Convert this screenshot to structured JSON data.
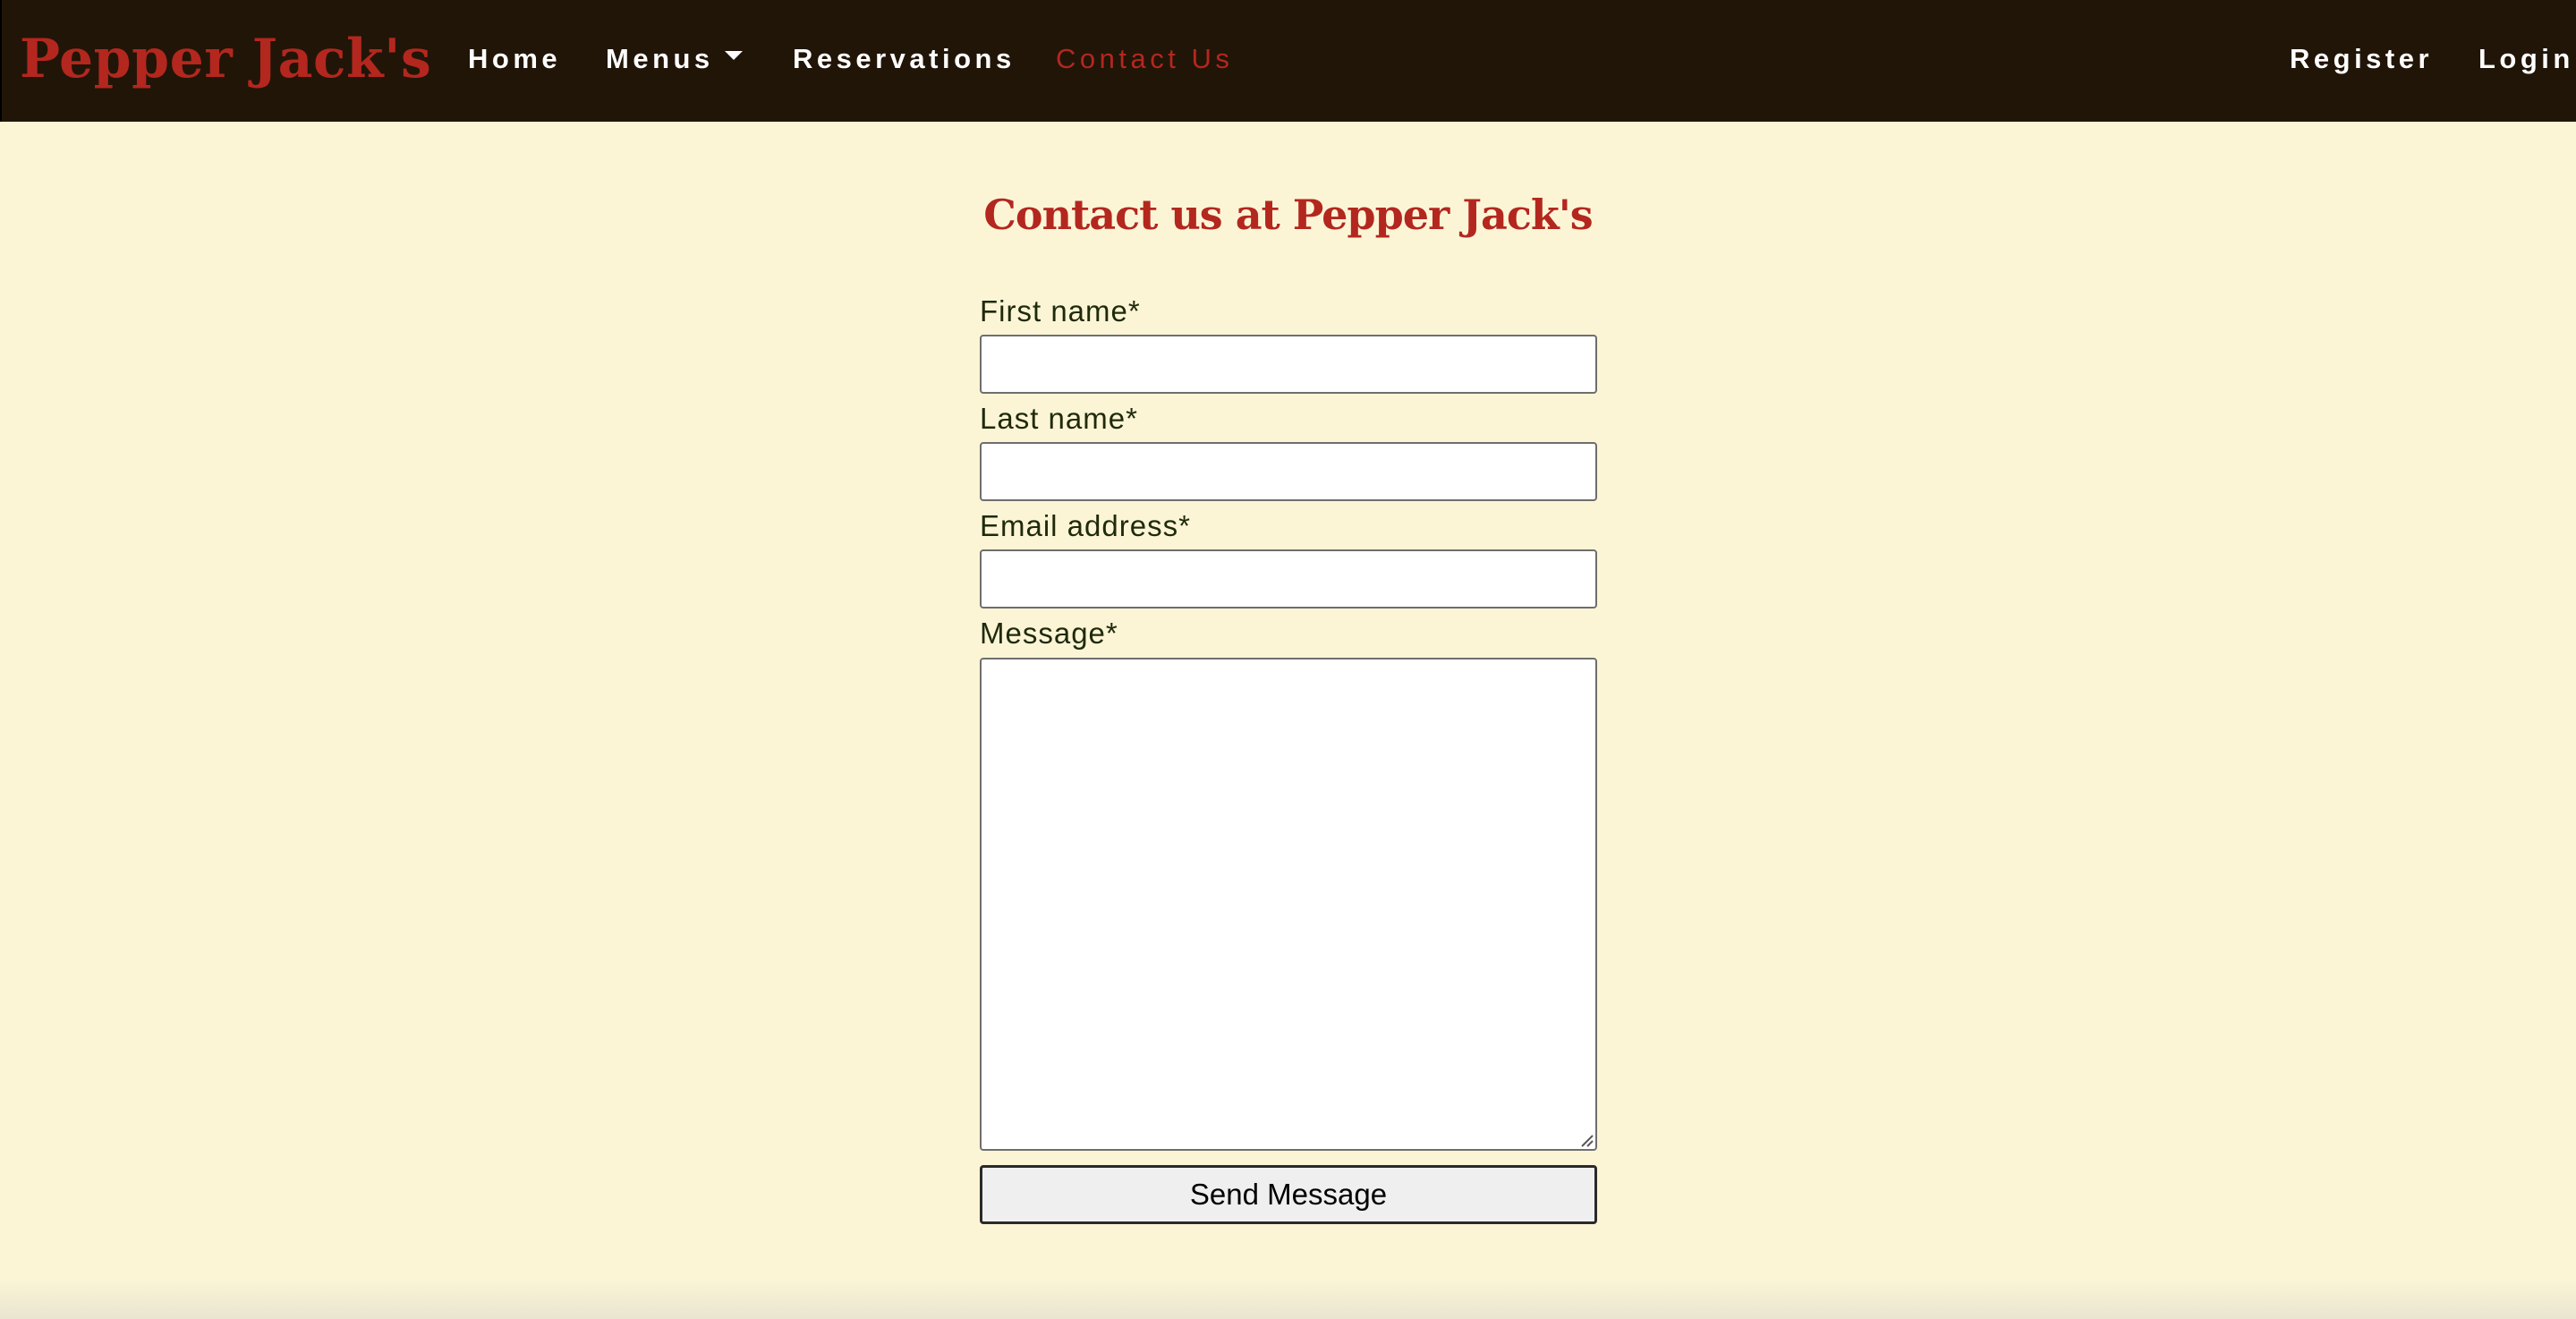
{
  "navbar": {
    "brand": "Pepper Jack's",
    "links": [
      {
        "label": "Home"
      },
      {
        "label": "Menus"
      },
      {
        "label": "Reservations"
      },
      {
        "label": "Contact Us"
      }
    ],
    "right_links": [
      {
        "label": "Register"
      },
      {
        "label": "Login"
      }
    ],
    "active_link": "Contact Us",
    "colors": {
      "background": "#211507",
      "brand": "#b3271f",
      "link": "#ffffff",
      "active_link": "#b3271f"
    }
  },
  "main": {
    "title": "Contact us at Pepper Jack's",
    "form": {
      "first_name_label": "First name*",
      "first_name_value": "",
      "last_name_label": "Last name*",
      "last_name_value": "",
      "email_label": "Email address*",
      "email_value": "",
      "message_label": "Message*",
      "message_value": "",
      "submit_label": "Send Message"
    },
    "colors": {
      "background": "#fbf5d6",
      "title": "#b3271f",
      "label": "#1f2a0b"
    }
  }
}
